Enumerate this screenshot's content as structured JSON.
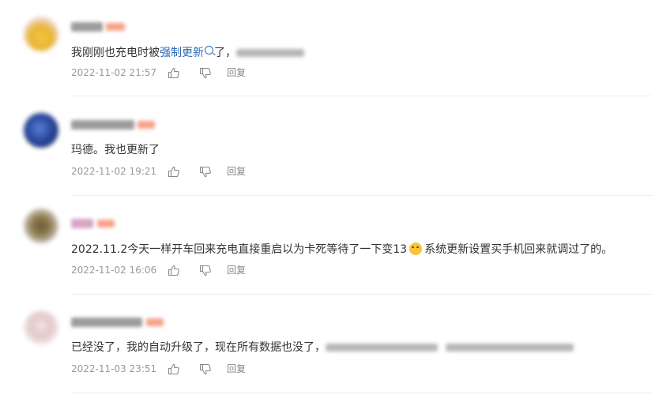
{
  "comments": [
    {
      "text_parts": [
        "我刚刚也充电时被",
        "强制更新",
        "了，"
      ],
      "time": "2022-11-02 21:57",
      "reply_label": "回复"
    },
    {
      "text": "玛德。我也更新了",
      "time": "2022-11-02 19:21",
      "reply_label": "回复"
    },
    {
      "text_parts": [
        "2022.11.2今天一样开车回来充电直接重启以为卡死等待了一下变13",
        "系统更新设置买手机回来就调过了的。"
      ],
      "time": "2022-11-02 16:06",
      "reply_label": "回复"
    },
    {
      "text": "已经没了，我的自动升级了，现在所有数据也没了，",
      "time": "2022-11-03 23:51",
      "reply_label": "回复"
    }
  ],
  "icons": {
    "like": "thumbs-up-icon",
    "dislike": "thumbs-down-icon",
    "search": "search-icon",
    "emoji": "laughing-emoji-icon"
  },
  "colors": {
    "link": "#2a6bb5",
    "meta": "#999999",
    "badge": "#f7a38a"
  }
}
